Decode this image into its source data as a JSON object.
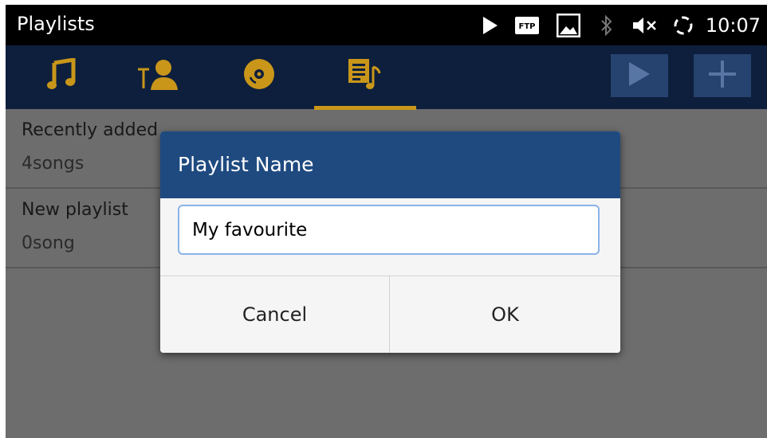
{
  "status_bar": {
    "title": "Playlists",
    "icons": [
      "play-icon",
      "ftp-icon",
      "image-icon",
      "bluetooth-icon",
      "volume-mute-icon",
      "sync-icon"
    ],
    "ftp_label": "FTP",
    "time": "10:07"
  },
  "tabs": [
    {
      "icon": "music-note-icon"
    },
    {
      "icon": "artist-icon"
    },
    {
      "icon": "album-disc-icon"
    },
    {
      "icon": "playlist-icon",
      "selected": true
    }
  ],
  "actions": [
    {
      "icon": "play-icon"
    },
    {
      "icon": "add-icon"
    }
  ],
  "playlists": [
    {
      "name": "Recently added",
      "count": "4songs"
    },
    {
      "name": "New playlist",
      "count": "0song"
    }
  ],
  "dialog": {
    "title": "Playlist Name",
    "input_value": "My favourite",
    "cancel_label": "Cancel",
    "ok_label": "OK"
  },
  "colors": {
    "tab_bar": "#0d1f3c",
    "tab_icon": "#c9961a",
    "dialog_header": "#1f4a80",
    "background_dimmed": "#6d6d6d"
  }
}
